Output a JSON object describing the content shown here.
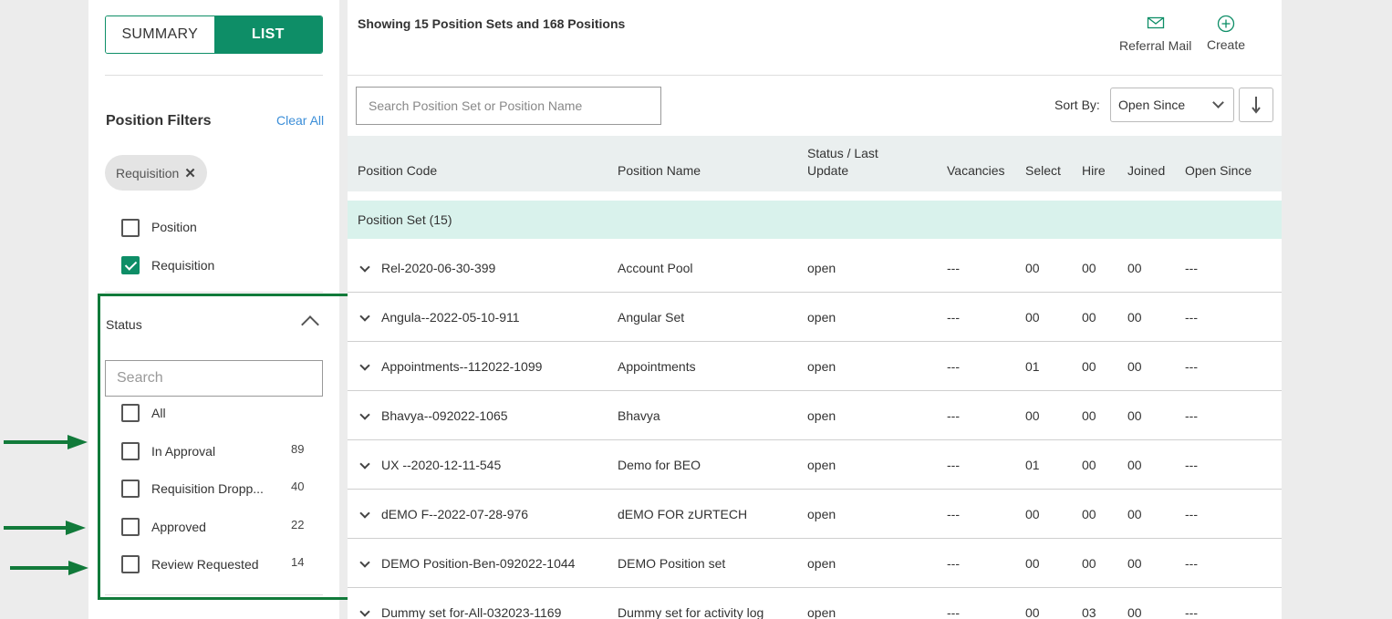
{
  "view_toggle": {
    "summary": "SUMMARY",
    "list": "LIST",
    "active": "list"
  },
  "filters": {
    "title": "Position Filters",
    "clear_all": "Clear All",
    "chip": {
      "label": "Requisition",
      "remove": "✕"
    },
    "types": [
      {
        "label": "Position",
        "checked": false
      },
      {
        "label": "Requisition",
        "checked": true
      }
    ],
    "status": {
      "title": "Status",
      "search_placeholder": "Search",
      "options": [
        {
          "label": "All",
          "count": ""
        },
        {
          "label": "In Approval",
          "count": "89"
        },
        {
          "label": "Requisition Dropp...",
          "count": "40"
        },
        {
          "label": "Approved",
          "count": "22"
        },
        {
          "label": "Review Requested",
          "count": "14"
        }
      ]
    }
  },
  "colors": {
    "accent": "#0e8e67",
    "group_row": "#d9f2ec",
    "annotation": "#117a3a",
    "link": "#3b8ed8"
  },
  "main": {
    "showing": "Showing 15 Position Sets and 168 Positions",
    "actions": [
      {
        "label": "Referral Mail",
        "icon": "mail-icon"
      },
      {
        "label": "Create",
        "icon": "plus-circle-icon"
      }
    ],
    "search_placeholder": "Search Position Set or Position Name",
    "sort_by_label": "Sort By:",
    "sort_value": "Open Since",
    "columns": {
      "code": "Position Code",
      "name": "Position Name",
      "status_1": "Status / Last",
      "status_2": "Update",
      "vacancies": "Vacancies",
      "select": "Select",
      "hire": "Hire",
      "joined": "Joined",
      "open_since": "Open Since"
    },
    "group_label": "Position Set (15)",
    "rows": [
      {
        "code": "Rel-2020-06-30-399",
        "name": "Account Pool",
        "status": "open",
        "vacancies": "---",
        "select": "00",
        "hire": "00",
        "joined": "00",
        "open_since": "---"
      },
      {
        "code": "Angula--2022-05-10-911",
        "name": "Angular Set",
        "status": "open",
        "vacancies": "---",
        "select": "00",
        "hire": "00",
        "joined": "00",
        "open_since": "---"
      },
      {
        "code": "Appointments--112022-1099",
        "name": "Appointments",
        "status": "open",
        "vacancies": "---",
        "select": "01",
        "hire": "00",
        "joined": "00",
        "open_since": "---"
      },
      {
        "code": "Bhavya--092022-1065",
        "name": "Bhavya",
        "status": "open",
        "vacancies": "---",
        "select": "00",
        "hire": "00",
        "joined": "00",
        "open_since": "---"
      },
      {
        "code": "UX --2020-12-11-545",
        "name": "Demo for BEO",
        "status": "open",
        "vacancies": "---",
        "select": "01",
        "hire": "00",
        "joined": "00",
        "open_since": "---"
      },
      {
        "code": "dEMO F--2022-07-28-976",
        "name": "dEMO FOR zURTECH",
        "status": "open",
        "vacancies": "---",
        "select": "00",
        "hire": "00",
        "joined": "00",
        "open_since": "---"
      },
      {
        "code": "DEMO Position-Ben-092022-1044",
        "name": "DEMO Position set",
        "status": "open",
        "vacancies": "---",
        "select": "00",
        "hire": "00",
        "joined": "00",
        "open_since": "---"
      },
      {
        "code": "Dummy set for-All-032023-1169",
        "name": "Dummy set for activity log",
        "status": "open",
        "vacancies": "---",
        "select": "00",
        "hire": "03",
        "joined": "00",
        "open_since": "---"
      }
    ]
  }
}
